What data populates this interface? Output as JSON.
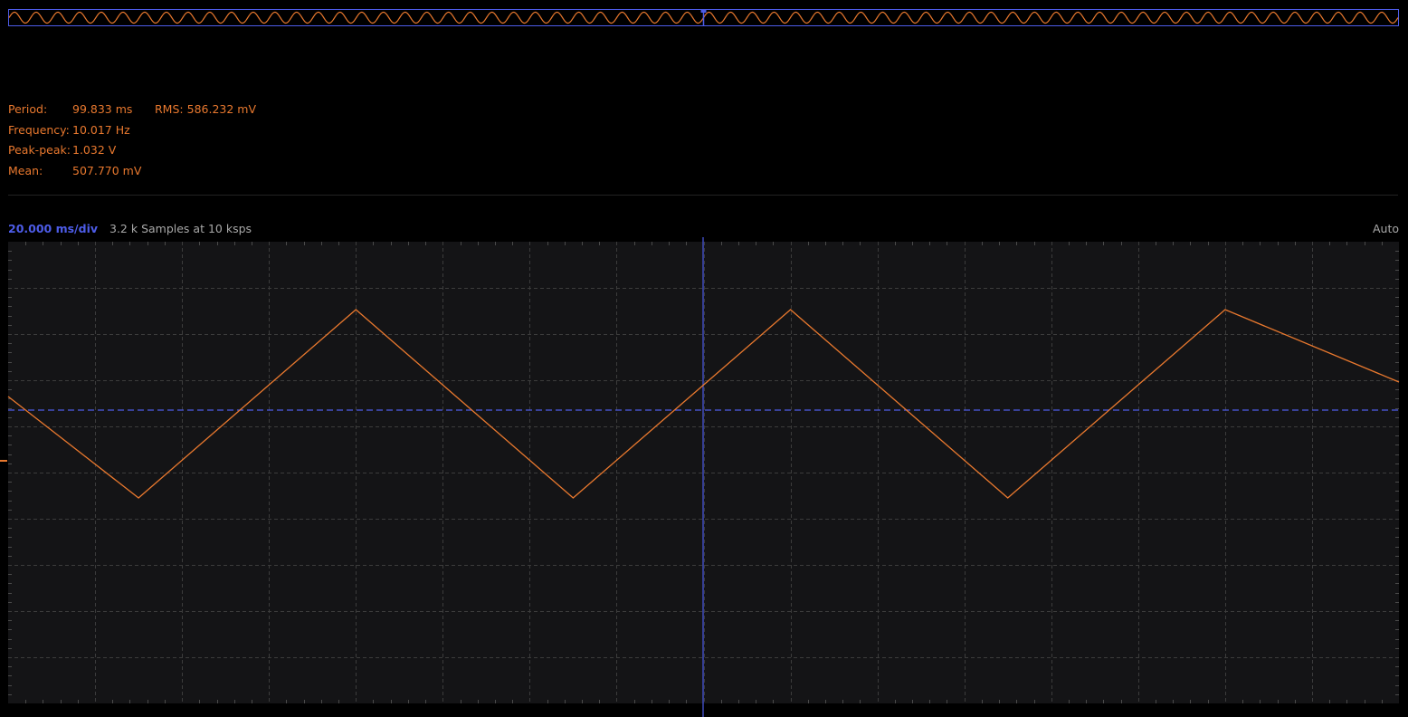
{
  "overview": {
    "trace_color": "#e8782e",
    "frame_color": "#4d5ce8",
    "marker_color": "#4d5ce8"
  },
  "measurements": {
    "period": {
      "label": "Period:",
      "value": "99.833 ms"
    },
    "rms": {
      "label": "RMS:",
      "value": "586.232 mV"
    },
    "frequency": {
      "label": "Frequency:",
      "value": "10.017 Hz"
    },
    "peak_peak": {
      "label": "Peak-peak:",
      "value": "1.032 V"
    },
    "mean": {
      "label": "Mean:",
      "value": "507.770 mV"
    }
  },
  "status": {
    "timebase": "20.000 ms/div",
    "samples": "3.2 k Samples at 10 ksps",
    "trigger_mode": "Auto"
  },
  "colors": {
    "background": "#000000",
    "grid_background": "#141416",
    "grid_line": "#3c3c3c",
    "trace": "#e8782e",
    "accent": "#4d5ce8",
    "measurement_text": "#e8782e",
    "muted_text": "#a8a8a8"
  },
  "scope": {
    "trace_vertices": [
      [
        0,
        0.1
      ],
      [
        0.3,
        -0.6
      ],
      [
        0.8,
        0.7
      ],
      [
        1.3,
        -0.6
      ],
      [
        1.8,
        0.7
      ],
      [
        2.3,
        -0.6
      ],
      [
        2.8,
        0.7
      ],
      [
        3.2,
        0.2
      ]
    ]
  }
}
